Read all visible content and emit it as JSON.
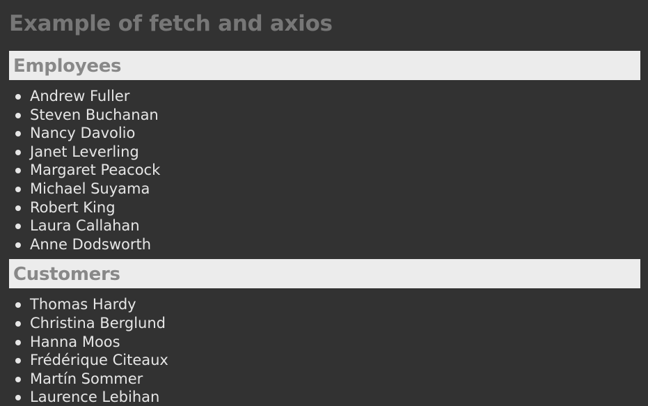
{
  "page": {
    "title": "Example of fetch and axios"
  },
  "employees": {
    "heading": "Employees",
    "items": [
      "Andrew Fuller",
      "Steven Buchanan",
      "Nancy Davolio",
      "Janet Leverling",
      "Margaret Peacock",
      "Michael Suyama",
      "Robert King",
      "Laura Callahan",
      "Anne Dodsworth"
    ]
  },
  "customers": {
    "heading": "Customers",
    "items": [
      "Thomas Hardy",
      "Christina Berglund",
      "Hanna Moos",
      "Frédérique Citeaux",
      "Martín Sommer",
      "Laurence Lebihan"
    ]
  },
  "colors": {
    "background": "#323232",
    "heading_bar": "#ececec",
    "title_text": "#777777",
    "heading_text": "#888888",
    "list_text": "#e6e6e6"
  }
}
